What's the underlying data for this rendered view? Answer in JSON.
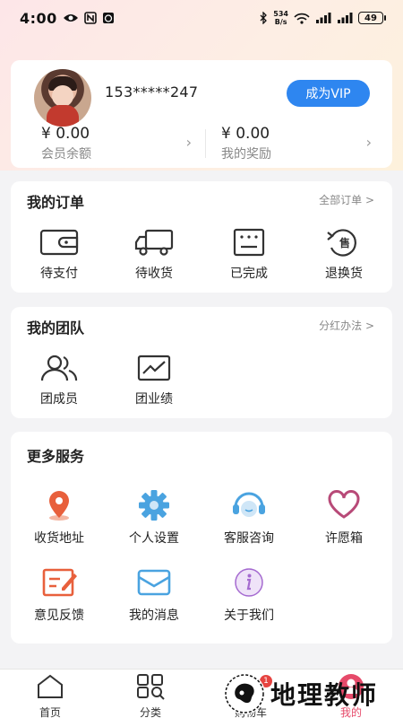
{
  "status_bar": {
    "time": "4:00",
    "net_speed_value": "534",
    "net_speed_unit": "B/s",
    "battery": "49"
  },
  "profile": {
    "phone": "153*****247",
    "vip_button": "成为VIP",
    "balance_amount": "¥ 0.00",
    "balance_label": "会员余额",
    "reward_amount": "¥ 0.00",
    "reward_label": "我的奖励"
  },
  "orders": {
    "title": "我的订单",
    "link": "全部订单 >",
    "items": [
      {
        "label": "待支付",
        "icon": "wallet-icon"
      },
      {
        "label": "待收货",
        "icon": "truck-icon"
      },
      {
        "label": "已完成",
        "icon": "completed-icon"
      },
      {
        "label": "退换货",
        "icon": "return-icon"
      }
    ]
  },
  "team": {
    "title": "我的团队",
    "link": "分红办法 >",
    "items": [
      {
        "label": "团成员",
        "icon": "members-icon"
      },
      {
        "label": "团业绩",
        "icon": "performance-icon"
      }
    ]
  },
  "services": {
    "title": "更多服务",
    "items": [
      {
        "label": "收货地址",
        "icon": "location-icon"
      },
      {
        "label": "个人设置",
        "icon": "gear-icon"
      },
      {
        "label": "客服咨询",
        "icon": "headset-icon"
      },
      {
        "label": "许愿箱",
        "icon": "heart-icon"
      },
      {
        "label": "意见反馈",
        "icon": "feedback-icon"
      },
      {
        "label": "我的消息",
        "icon": "message-icon"
      },
      {
        "label": "关于我们",
        "icon": "info-icon"
      }
    ]
  },
  "bottom_nav": {
    "home": "首页",
    "category": "分类",
    "cart": "购物车",
    "cart_badge": "1",
    "mine": "我的"
  },
  "watermark": {
    "text": "地理教师"
  },
  "colors": {
    "accent": "#2e86f0",
    "orange": "#e8603c",
    "blue": "#4aa3e0",
    "pink": "#b84a78",
    "purple": "#a56ad0"
  }
}
